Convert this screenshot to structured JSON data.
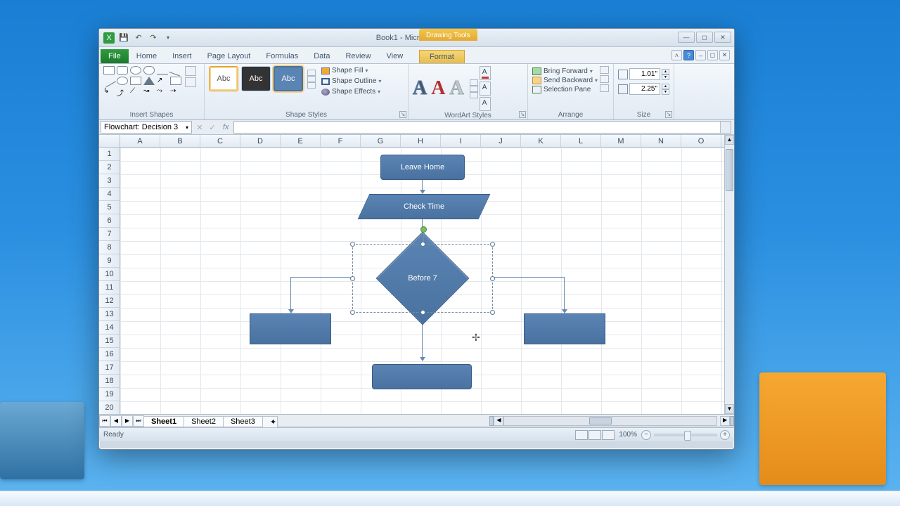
{
  "titlebar": {
    "title": "Book1 - Microsoft Excel",
    "context": "Drawing Tools"
  },
  "tabs": {
    "file": "File",
    "home": "Home",
    "insert": "Insert",
    "page_layout": "Page Layout",
    "formulas": "Formulas",
    "data": "Data",
    "review": "Review",
    "view": "View",
    "format": "Format"
  },
  "ribbon": {
    "insert_shapes": "Insert Shapes",
    "shape_styles": "Shape Styles",
    "style_sample": "Abc",
    "shape_fill": "Shape Fill",
    "shape_outline": "Shape Outline",
    "shape_effects": "Shape Effects",
    "wordart_styles": "WordArt Styles",
    "wa_sample": "A",
    "arrange": "Arrange",
    "bring_forward": "Bring Forward",
    "send_backward": "Send Backward",
    "selection_pane": "Selection Pane",
    "size": "Size",
    "height": "1.01\"",
    "width": "2.25\""
  },
  "formula": {
    "namebox": "Flowchart: Decision 3",
    "fx": "fx"
  },
  "columns": [
    "A",
    "B",
    "C",
    "D",
    "E",
    "F",
    "G",
    "H",
    "I",
    "J",
    "K",
    "L",
    "M",
    "N",
    "O"
  ],
  "rows": [
    "1",
    "2",
    "3",
    "4",
    "5",
    "6",
    "7",
    "8",
    "9",
    "10",
    "11",
    "12",
    "13",
    "14",
    "15",
    "16",
    "17",
    "18",
    "19",
    "20"
  ],
  "flowchart": {
    "leave_home": "Leave Home",
    "check_time": "Check Time",
    "before_7": "Before 7"
  },
  "sheets": {
    "s1": "Sheet1",
    "s2": "Sheet2",
    "s3": "Sheet3"
  },
  "status": {
    "ready": "Ready",
    "zoom": "100%"
  }
}
